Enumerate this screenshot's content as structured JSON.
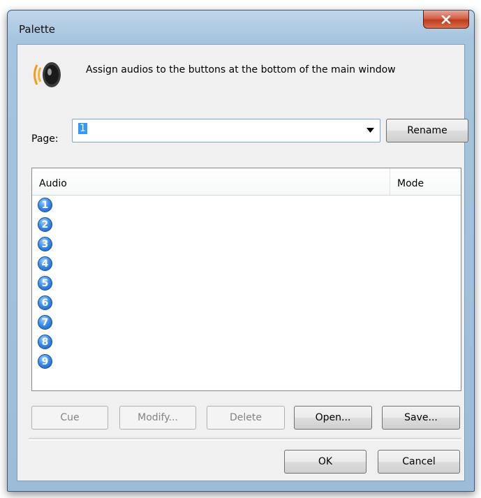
{
  "window": {
    "title": "Palette"
  },
  "header": {
    "text": "Assign audios to the buttons at the bottom of the main window",
    "icon": "speaker-icon"
  },
  "page": {
    "label": "Page:",
    "value": "1",
    "rename_label": "Rename"
  },
  "list": {
    "columns": [
      "Audio",
      "Mode"
    ],
    "rows": [
      {
        "num": "1",
        "audio": "",
        "mode": ""
      },
      {
        "num": "2",
        "audio": "",
        "mode": ""
      },
      {
        "num": "3",
        "audio": "",
        "mode": ""
      },
      {
        "num": "4",
        "audio": "",
        "mode": ""
      },
      {
        "num": "5",
        "audio": "",
        "mode": ""
      },
      {
        "num": "6",
        "audio": "",
        "mode": ""
      },
      {
        "num": "7",
        "audio": "",
        "mode": ""
      },
      {
        "num": "8",
        "audio": "",
        "mode": ""
      },
      {
        "num": "9",
        "audio": "",
        "mode": ""
      }
    ]
  },
  "actions": {
    "cue": "Cue",
    "modify": "Modify...",
    "delete": "Delete",
    "open": "Open...",
    "save": "Save..."
  },
  "footer": {
    "ok": "OK",
    "cancel": "Cancel"
  },
  "colors": {
    "accent": "#3399ff",
    "titlebar": "#a7c4de",
    "close": "#c13a1c"
  }
}
